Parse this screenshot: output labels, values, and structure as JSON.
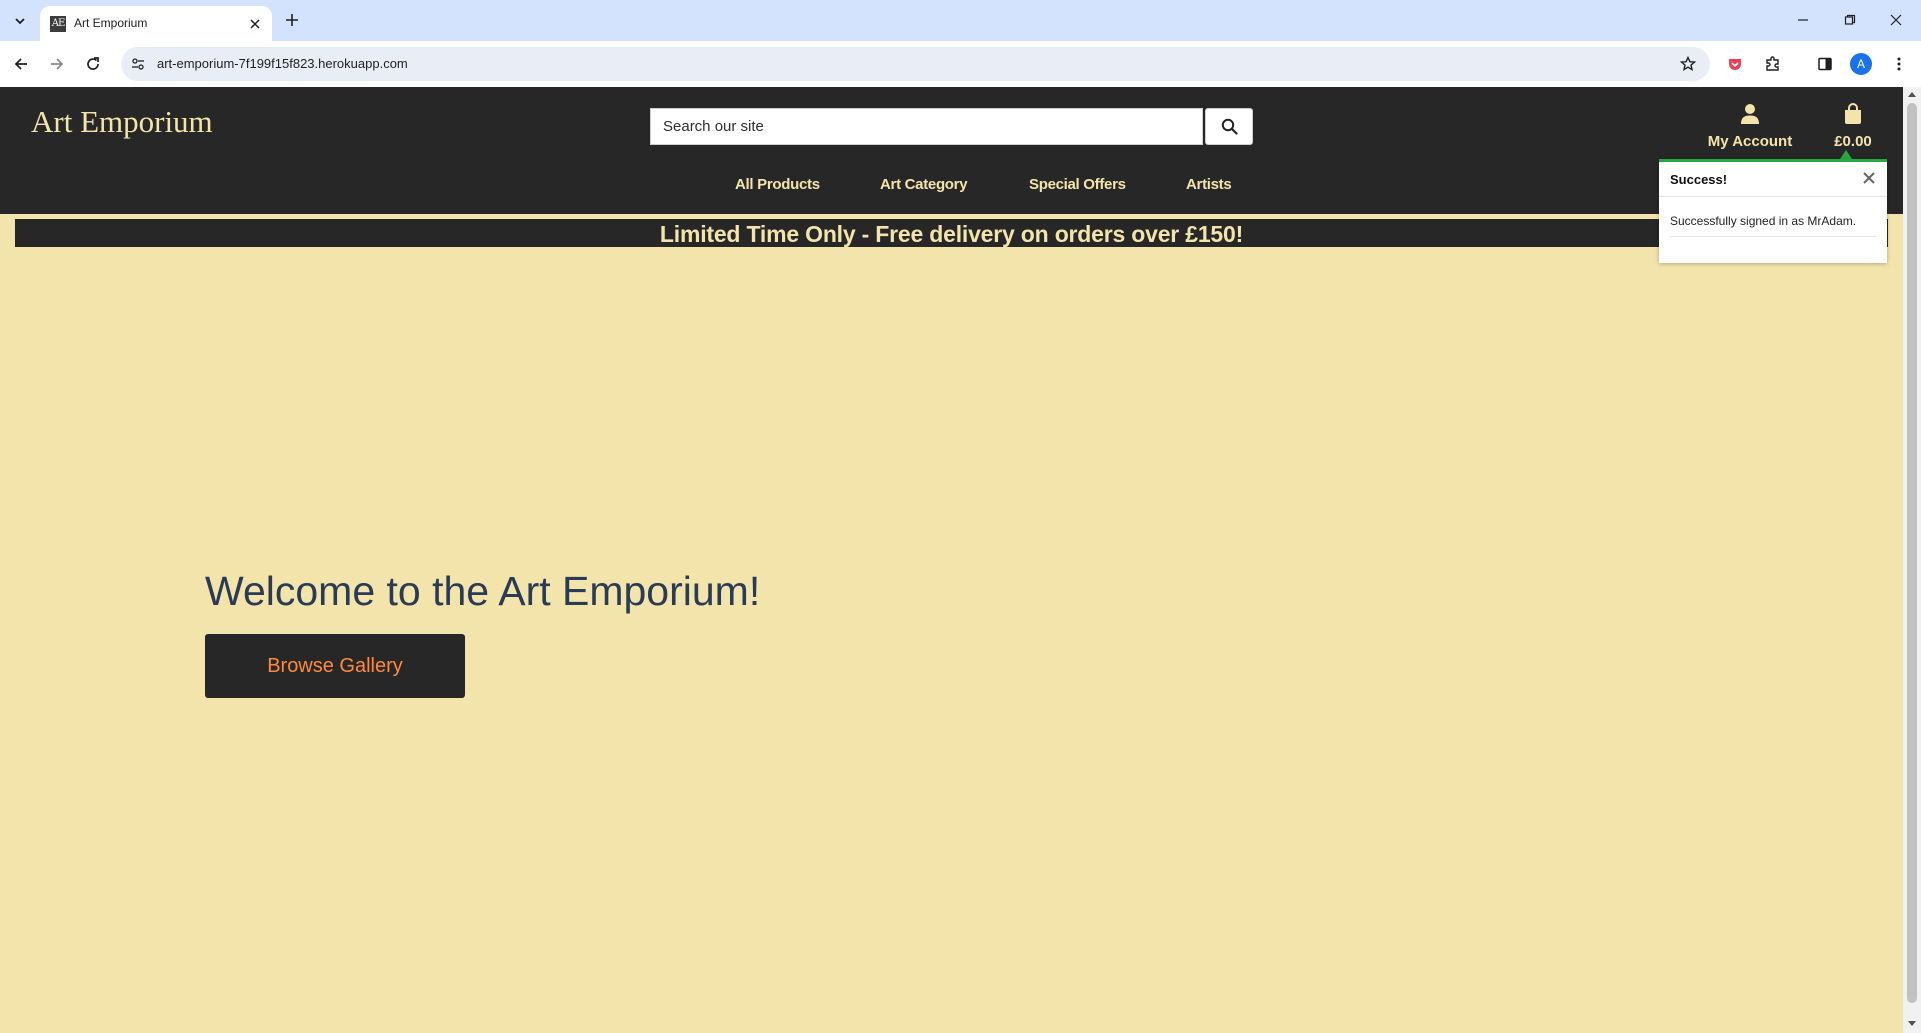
{
  "browser": {
    "tab_title": "Art Emporium",
    "favicon_text": "AE",
    "url": "art-emporium-7f199f15f823.herokuapp.com",
    "profile_initial": "A"
  },
  "header": {
    "brand": "Art Emporium",
    "search_placeholder": "Search our site",
    "account_label": "My Account",
    "bag_total": "£0.00"
  },
  "nav": {
    "items": [
      {
        "label": "All Products"
      },
      {
        "label": "Art Category"
      },
      {
        "label": "Special Offers"
      },
      {
        "label": "Artists"
      }
    ]
  },
  "promo": {
    "text": "Limited Time Only - Free delivery on orders over £150!"
  },
  "hero": {
    "title": "Welcome to the Art Emporium!",
    "button_label": "Browse Gallery"
  },
  "toast": {
    "title": "Success!",
    "message": "Successfully signed in as MrAdam."
  },
  "colors": {
    "page_bg": "#f3e4ab",
    "header_bg": "#272727",
    "accent_text": "#f3e4ab",
    "hero_text": "#2a3c55",
    "button_text": "#ff8a3c",
    "success": "#28a745"
  }
}
